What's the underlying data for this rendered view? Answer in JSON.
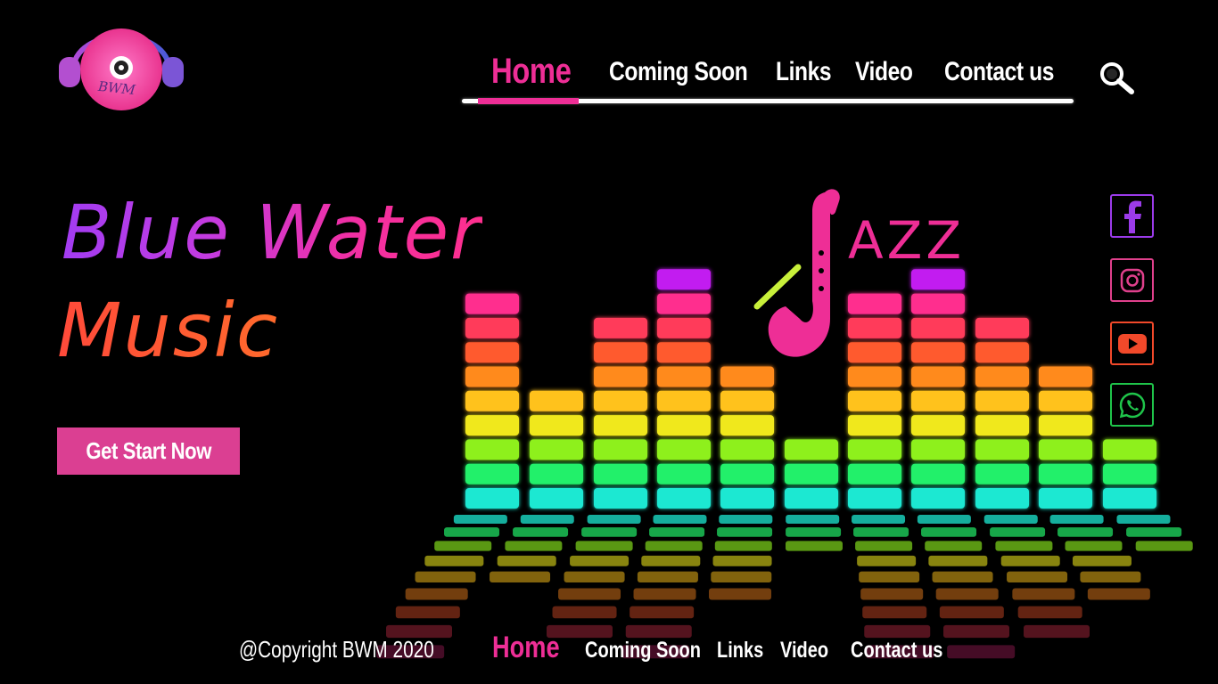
{
  "logo": {
    "text": "BWM"
  },
  "nav": {
    "items": [
      {
        "label": "Home",
        "active": true
      },
      {
        "label": "Coming Soon"
      },
      {
        "label": "Links"
      },
      {
        "label": "Video"
      },
      {
        "label": "Contact us"
      }
    ],
    "search_icon": "search-icon"
  },
  "hero": {
    "line1": "Blue Water",
    "line2": "Music",
    "cta_label": "Get Start Now"
  },
  "jazz": {
    "text": "AZZ"
  },
  "social": [
    {
      "name": "facebook-icon",
      "color": "#9b3bea"
    },
    {
      "name": "instagram-icon",
      "color": "#e0408c"
    },
    {
      "name": "youtube-icon",
      "color": "#f2492a"
    },
    {
      "name": "whatsapp-icon",
      "color": "#1fc44a"
    }
  ],
  "footer": {
    "copyright": "@Copyright BWM 2020",
    "items": [
      {
        "label": "Home",
        "active": true
      },
      {
        "label": "Coming Soon"
      },
      {
        "label": "Links"
      },
      {
        "label": "Video"
      },
      {
        "label": "Contact us"
      }
    ]
  },
  "colors": {
    "accent": "#ee2e96",
    "cta": "#db3f92",
    "background": "#000000"
  }
}
